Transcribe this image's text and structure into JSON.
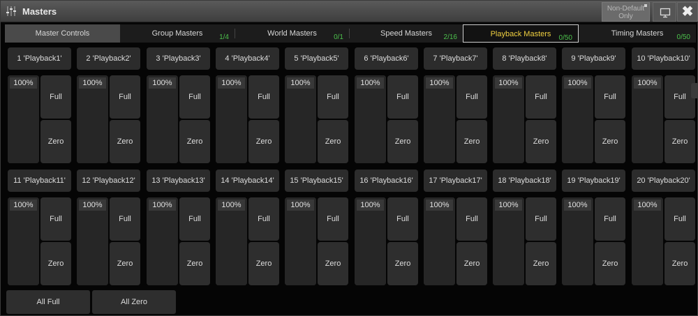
{
  "window": {
    "title": "Masters",
    "non_default_label_line1": "Non-Default",
    "non_default_label_line2": "Only",
    "close_glyph": "✖"
  },
  "tabs": [
    {
      "label": "Master Controls",
      "count": ""
    },
    {
      "label": "Group Masters",
      "count": "1/4"
    },
    {
      "label": "World Masters",
      "count": "0/1"
    },
    {
      "label": "Speed Masters",
      "count": "2/16"
    },
    {
      "label": "Playback Masters",
      "count": "0/50"
    },
    {
      "label": "Timing Masters",
      "count": "0/50"
    }
  ],
  "active_tab": "Playback Masters",
  "playbacks": [
    {
      "name": "1 'Playback1'",
      "level": "100%",
      "level_fraction": 1.0,
      "full": "Full",
      "zero": "Zero"
    },
    {
      "name": "2 'Playback2'",
      "level": "100%",
      "level_fraction": 1.0,
      "full": "Full",
      "zero": "Zero"
    },
    {
      "name": "3 'Playback3'",
      "level": "100%",
      "level_fraction": 1.0,
      "full": "Full",
      "zero": "Zero"
    },
    {
      "name": "4 'Playback4'",
      "level": "100%",
      "level_fraction": 1.0,
      "full": "Full",
      "zero": "Zero"
    },
    {
      "name": "5 'Playback5'",
      "level": "100%",
      "level_fraction": 1.0,
      "full": "Full",
      "zero": "Zero"
    },
    {
      "name": "6 'Playback6'",
      "level": "100%",
      "level_fraction": 1.0,
      "full": "Full",
      "zero": "Zero"
    },
    {
      "name": "7 'Playback7'",
      "level": "100%",
      "level_fraction": 1.0,
      "full": "Full",
      "zero": "Zero"
    },
    {
      "name": "8 'Playback8'",
      "level": "100%",
      "level_fraction": 1.0,
      "full": "Full",
      "zero": "Zero"
    },
    {
      "name": "9 'Playback9'",
      "level": "100%",
      "level_fraction": 1.0,
      "full": "Full",
      "zero": "Zero"
    },
    {
      "name": "10 'Playback10'",
      "level": "100%",
      "level_fraction": 1.0,
      "full": "Full",
      "zero": "Zero"
    },
    {
      "name": "11 'Playback11'",
      "level": "100%",
      "level_fraction": 1.0,
      "full": "Full",
      "zero": "Zero"
    },
    {
      "name": "12 'Playback12'",
      "level": "100%",
      "level_fraction": 1.0,
      "full": "Full",
      "zero": "Zero"
    },
    {
      "name": "13 'Playback13'",
      "level": "100%",
      "level_fraction": 1.0,
      "full": "Full",
      "zero": "Zero"
    },
    {
      "name": "14 'Playback14'",
      "level": "100%",
      "level_fraction": 1.0,
      "full": "Full",
      "zero": "Zero"
    },
    {
      "name": "15 'Playback15'",
      "level": "100%",
      "level_fraction": 1.0,
      "full": "Full",
      "zero": "Zero"
    },
    {
      "name": "16 'Playback16'",
      "level": "100%",
      "level_fraction": 1.0,
      "full": "Full",
      "zero": "Zero"
    },
    {
      "name": "17 'Playback17'",
      "level": "100%",
      "level_fraction": 1.0,
      "full": "Full",
      "zero": "Zero"
    },
    {
      "name": "18 'Playback18'",
      "level": "100%",
      "level_fraction": 1.0,
      "full": "Full",
      "zero": "Zero"
    },
    {
      "name": "19 'Playback19'",
      "level": "100%",
      "level_fraction": 1.0,
      "full": "Full",
      "zero": "Zero"
    },
    {
      "name": "20 'Playback20'",
      "level": "100%",
      "level_fraction": 1.0,
      "full": "Full",
      "zero": "Zero"
    }
  ],
  "bottom": {
    "all_full": "All Full",
    "all_zero": "All Zero"
  },
  "colors": {
    "active_tab_text": "#f0d040",
    "count_text": "#4cc24c"
  },
  "icons": {
    "title": "faders-icon",
    "display": "monitor-icon",
    "close": "close-icon"
  }
}
